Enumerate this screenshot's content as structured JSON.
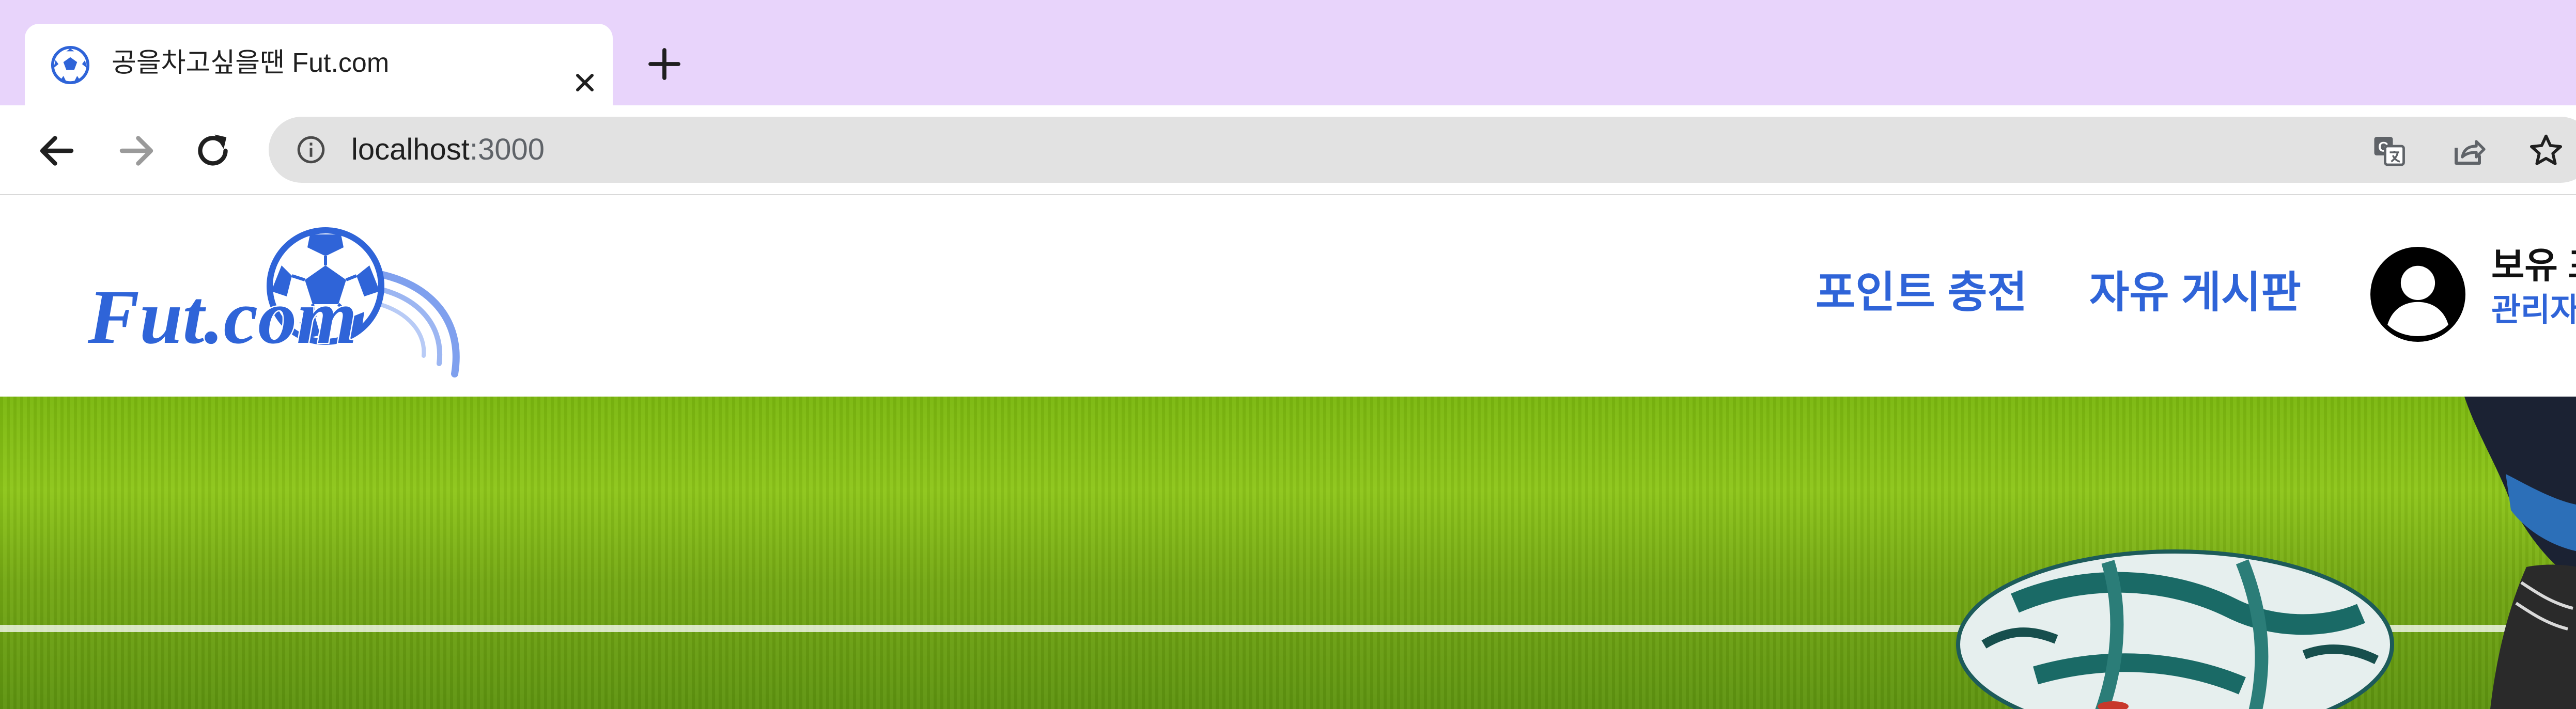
{
  "browser": {
    "tab": {
      "title": "공을차고싶을땐 Fut.com",
      "favicon": "soccer-ball-icon",
      "close_icon": "close-icon"
    },
    "new_tab_icon": "plus-icon",
    "toolbar": {
      "back_icon": "back-arrow-icon",
      "forward_icon": "forward-arrow-icon",
      "reload_icon": "reload-icon",
      "site_info_icon": "info-icon",
      "url_host": "localhost",
      "url_port": ":3000",
      "right_icons": [
        "translate-icon",
        "share-icon",
        "bookmark-star-icon"
      ]
    },
    "colors": {
      "tabstrip_bg": "#e8d4fb",
      "omnibox_bg": "#e2e2e2"
    }
  },
  "site": {
    "logo_text": "Fut.com",
    "nav": [
      {
        "label": "포인트 충전"
      },
      {
        "label": "자유 게시판"
      }
    ],
    "user": {
      "avatar_icon": "user-avatar-icon",
      "points_label": "보유 포",
      "role_label": "관리자"
    },
    "colors": {
      "accent": "#2f64d8",
      "hero_grass": "#7bb80f"
    }
  }
}
